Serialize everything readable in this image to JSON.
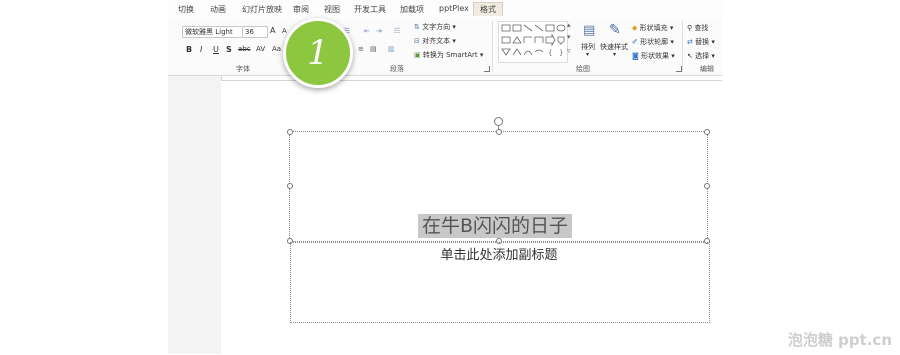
{
  "tabs": [
    "切换",
    "动画",
    "幻灯片放映",
    "审阅",
    "视图",
    "开发工具",
    "加载项",
    "pptPlex",
    "格式"
  ],
  "font": {
    "name": "微软雅黑 Light",
    "size": "36",
    "grow": "A",
    "shrink": "A",
    "bold": "B",
    "italic": "I",
    "underline": "U",
    "shadow": "S",
    "strike": "abc",
    "spacing": "AV",
    "case": "Aa",
    "group_label": "字体"
  },
  "paragraph": {
    "text_direction": "文字方向",
    "align_text": "对齐文本",
    "convert_smartart": "转换为 SmartArt",
    "group_label": "段落"
  },
  "drawing": {
    "arrange": "排列",
    "quick_styles": "快速样式",
    "shape_fill": "形状填充",
    "shape_outline": "形状轮廓",
    "shape_effects": "形状效果",
    "group_label": "绘图"
  },
  "editing": {
    "find": "查找",
    "replace": "替换",
    "select": "选择",
    "group_label": "编辑"
  },
  "step_badge": "1",
  "slide": {
    "title": "在牛B闪闪的日子",
    "subtitle": "单击此处添加副标题"
  },
  "watermark": "泡泡糖  ppt.cn",
  "colors": {
    "badge": "#8dc63f",
    "title_highlight": "#c8c8c8",
    "active_tab": "#f0ebe0"
  }
}
